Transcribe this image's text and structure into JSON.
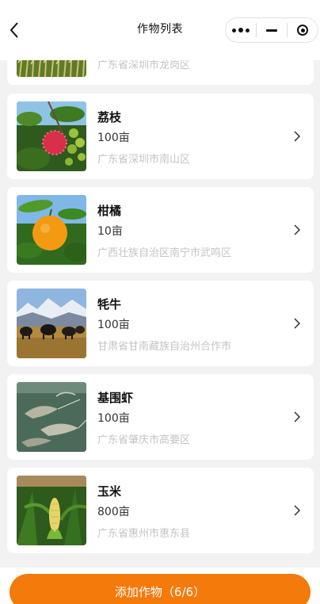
{
  "nav": {
    "title": "作物列表",
    "back_icon": "chevron-left-icon",
    "capsule": [
      "more-dots-icon",
      "minimize-icon",
      "target-icon"
    ]
  },
  "crops": [
    {
      "name": "",
      "area": "",
      "location": "广东省深圳市龙岗区",
      "image": "rice-field"
    },
    {
      "name": "荔枝",
      "area": "100亩",
      "location": "广东省深圳市南山区",
      "image": "lychee"
    },
    {
      "name": "柑橘",
      "area": "10亩",
      "location": "广西壮族自治区南宁市武鸣区",
      "image": "citrus"
    },
    {
      "name": "牦牛",
      "area": "100亩",
      "location": "甘肃省甘南藏族自治州合作市",
      "image": "yak"
    },
    {
      "name": "基围虾",
      "area": "100亩",
      "location": "广东省肇庆市高要区",
      "image": "shrimp"
    },
    {
      "name": "玉米",
      "area": "800亩",
      "location": "广东省惠州市惠东县",
      "image": "corn"
    }
  ],
  "footer": {
    "add_button_label": "添加作物（6/6）"
  },
  "colors": {
    "accent": "#f57a0c",
    "location_text": "#c4c4c4",
    "background": "#f2f2f2"
  }
}
